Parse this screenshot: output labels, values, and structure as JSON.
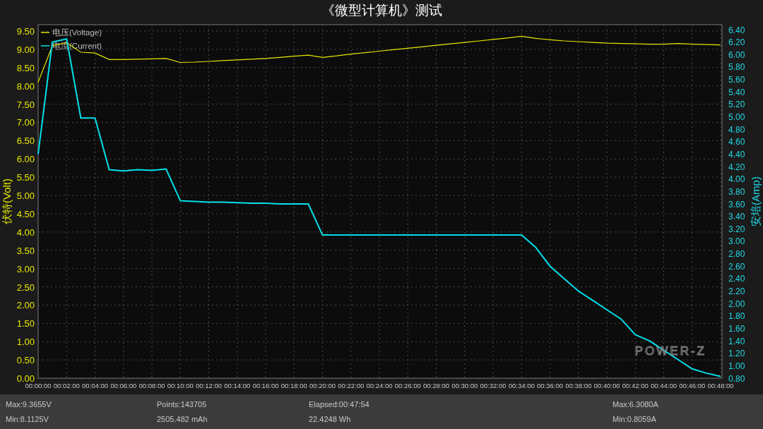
{
  "window": {
    "title": "《微型计算机》测试"
  },
  "chart": {
    "logo": "POWER-Z",
    "chart_data": {
      "type": "line",
      "grid": true,
      "legend": "upper left",
      "ylabel": "伏特(Volt)",
      "y2label": "安培(Amp)",
      "x": [
        0,
        1,
        2,
        3,
        4,
        5,
        6,
        7,
        8,
        9,
        10,
        11,
        12,
        13,
        14,
        15,
        16,
        17,
        18,
        19,
        20,
        21,
        22,
        23,
        24,
        25,
        26,
        27,
        28,
        29,
        30,
        31,
        32,
        33,
        34,
        35,
        36,
        37,
        38,
        39,
        40,
        41,
        42,
        43,
        44,
        45,
        46,
        47,
        48
      ],
      "xlim": [
        0,
        48
      ],
      "xticks": [
        {
          "value": 0,
          "label": "00:00:00"
        },
        {
          "value": 2,
          "label": "00:02:00"
        },
        {
          "value": 4,
          "label": "00:04:00"
        },
        {
          "value": 6,
          "label": "00:06:00"
        },
        {
          "value": 8,
          "label": "00:08:00"
        },
        {
          "value": 10,
          "label": "00:10:00"
        },
        {
          "value": 12,
          "label": "00:12:00"
        },
        {
          "value": 14,
          "label": "00:14:00"
        },
        {
          "value": 16,
          "label": "00:16:00"
        },
        {
          "value": 18,
          "label": "00:18:00"
        },
        {
          "value": 20,
          "label": "00:20:00"
        },
        {
          "value": 22,
          "label": "00:22:00"
        },
        {
          "value": 24,
          "label": "00:24:00"
        },
        {
          "value": 26,
          "label": "00:26:00"
        },
        {
          "value": 28,
          "label": "00:28:00"
        },
        {
          "value": 30,
          "label": "00:30:00"
        },
        {
          "value": 32,
          "label": "00:32:00"
        },
        {
          "value": 34,
          "label": "00:34:00"
        },
        {
          "value": 36,
          "label": "00:36:00"
        },
        {
          "value": 38,
          "label": "00:38:00"
        },
        {
          "value": 40,
          "label": "00:40:00"
        },
        {
          "value": 42,
          "label": "00:42:00"
        },
        {
          "value": 44,
          "label": "00:44:00"
        },
        {
          "value": 46,
          "label": "00:46:00"
        },
        {
          "value": 48,
          "label": "00:48:00"
        }
      ],
      "ylim": [
        0,
        9.5
      ],
      "yticks": [
        {
          "value": 0,
          "label": "0.00"
        },
        {
          "value": 0.5,
          "label": "0.50"
        },
        {
          "value": 1,
          "label": "1.00"
        },
        {
          "value": 1.5,
          "label": "1.50"
        },
        {
          "value": 2,
          "label": "2.00"
        },
        {
          "value": 2.5,
          "label": "2.50"
        },
        {
          "value": 3,
          "label": "3.00"
        },
        {
          "value": 3.5,
          "label": "3.50"
        },
        {
          "value": 4,
          "label": "4.00"
        },
        {
          "value": 4.5,
          "label": "4.50"
        },
        {
          "value": 5,
          "label": "5.00"
        },
        {
          "value": 5.5,
          "label": "5.50"
        },
        {
          "value": 6,
          "label": "6.00"
        },
        {
          "value": 6.5,
          "label": "6.50"
        },
        {
          "value": 7,
          "label": "7.00"
        },
        {
          "value": 7.5,
          "label": "7.50"
        },
        {
          "value": 8,
          "label": "8.00"
        },
        {
          "value": 8.5,
          "label": "8.50"
        },
        {
          "value": 9,
          "label": "9.00"
        },
        {
          "value": 9.5,
          "label": "9.50"
        }
      ],
      "y2lim": [
        0.8,
        6.4
      ],
      "y2ticks": [
        {
          "value": 0.8,
          "label": "0.80"
        },
        {
          "value": 1,
          "label": "1.00"
        },
        {
          "value": 1.2,
          "label": "1.20"
        },
        {
          "value": 1.4,
          "label": "1.40"
        },
        {
          "value": 1.6,
          "label": "1.60"
        },
        {
          "value": 1.8,
          "label": "1.80"
        },
        {
          "value": 2,
          "label": "2.00"
        },
        {
          "value": 2.2,
          "label": "2.20"
        },
        {
          "value": 2.4,
          "label": "2.40"
        },
        {
          "value": 2.6,
          "label": "2.60"
        },
        {
          "value": 2.8,
          "label": "2.80"
        },
        {
          "value": 3,
          "label": "3.00"
        },
        {
          "value": 3.2,
          "label": "3.20"
        },
        {
          "value": 3.4,
          "label": "3.40"
        },
        {
          "value": 3.6,
          "label": "3.60"
        },
        {
          "value": 3.8,
          "label": "3.80"
        },
        {
          "value": 4,
          "label": "4.00"
        },
        {
          "value": 4.2,
          "label": "4.20"
        },
        {
          "value": 4.4,
          "label": "4.40"
        },
        {
          "value": 4.6,
          "label": "4.60"
        },
        {
          "value": 4.8,
          "label": "4.80"
        },
        {
          "value": 5,
          "label": "5.00"
        },
        {
          "value": 5.2,
          "label": "5.20"
        },
        {
          "value": 5.4,
          "label": "5.40"
        },
        {
          "value": 5.6,
          "label": "5.60"
        },
        {
          "value": 5.8,
          "label": "5.80"
        },
        {
          "value": 6,
          "label": "6.00"
        },
        {
          "value": 6.2,
          "label": "6.20"
        },
        {
          "value": 6.4,
          "label": "6.40"
        }
      ],
      "series": [
        {
          "name": "电压(Voltage)",
          "color": "#e6e600",
          "axis": "y",
          "values": [
            8.1,
            9.1,
            9.18,
            8.92,
            8.9,
            8.72,
            8.72,
            8.73,
            8.74,
            8.75,
            8.64,
            8.65,
            8.67,
            8.69,
            8.71,
            8.73,
            8.75,
            8.78,
            8.81,
            8.84,
            8.78,
            8.82,
            8.87,
            8.91,
            8.95,
            8.99,
            9.03,
            9.07,
            9.11,
            9.15,
            9.19,
            9.23,
            9.27,
            9.31,
            9.36,
            9.3,
            9.26,
            9.23,
            9.21,
            9.19,
            9.17,
            9.16,
            9.15,
            9.14,
            9.14,
            9.16,
            9.14,
            9.13,
            9.12
          ]
        },
        {
          "name": "电流(Current)",
          "color": "#00e0ea",
          "axis": "y2",
          "values": [
            4.4,
            6.2,
            6.25,
            4.98,
            4.98,
            4.15,
            4.13,
            4.15,
            4.14,
            4.16,
            3.65,
            3.64,
            3.63,
            3.63,
            3.62,
            3.61,
            3.61,
            3.6,
            3.6,
            3.6,
            3.1,
            3.1,
            3.1,
            3.1,
            3.1,
            3.1,
            3.1,
            3.1,
            3.1,
            3.1,
            3.1,
            3.1,
            3.1,
            3.1,
            3.1,
            2.9,
            2.6,
            2.4,
            2.2,
            2.05,
            1.9,
            1.75,
            1.5,
            1.4,
            1.25,
            1.1,
            0.95,
            0.88,
            0.83
          ]
        }
      ]
    }
  },
  "stats": [
    [
      "Max:9.3655V",
      "Min:8.1125V"
    ],
    [
      "Points:143705",
      "2505.482 mAh"
    ],
    [
      "Elapsed:00:47:54",
      "22.4248 Wh"
    ],
    [
      "Max:6.3080A",
      "Min:0.8059A"
    ]
  ]
}
